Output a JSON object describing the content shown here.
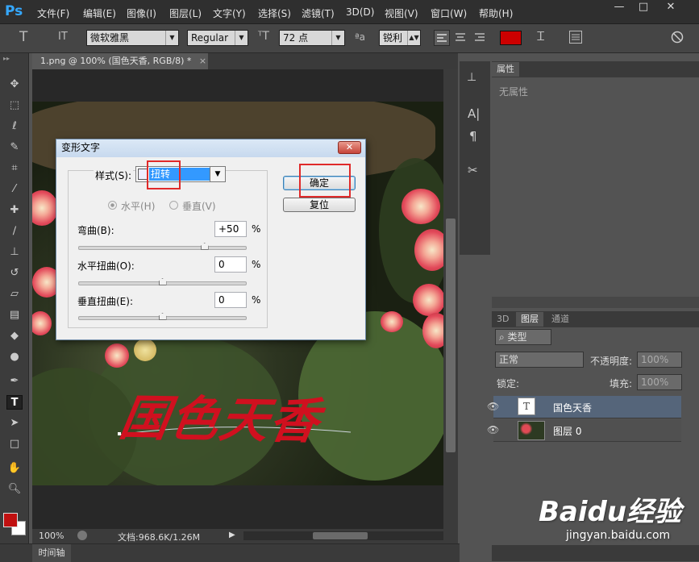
{
  "app": {
    "logo": "Ps",
    "accent_color": "#35a8ff"
  },
  "menu": [
    "文件(F)",
    "编辑(E)",
    "图像(I)",
    "图层(L)",
    "文字(Y)",
    "选择(S)",
    "滤镜(T)",
    "3D(D)",
    "视图(V)",
    "窗口(W)",
    "帮助(H)"
  ],
  "window_controls": {
    "minimize": "—",
    "maximize": "□",
    "close": "✕"
  },
  "options": {
    "tool_icon": "T",
    "orientation_icon": "IT",
    "font_family": "微软雅黑",
    "font_style": "Regular",
    "font_size": "72 点",
    "aa_label": "ªa",
    "antialias": "锐利",
    "text_color": "#cc0000"
  },
  "document": {
    "tab_title": "1.png @ 100% (国色天香, RGB/8) *",
    "close": "×",
    "text": "国色天香",
    "text_color": "#d0101f"
  },
  "dialog": {
    "title": "变形文字",
    "close": "✕",
    "style_label": "样式(S):",
    "style_value": "扭转",
    "orient_h": "水平(H)",
    "orient_v": "垂直(V)",
    "bend_label": "弯曲(B):",
    "bend_value": "+50",
    "bend_level": 0.75,
    "hdist_label": "水平扭曲(O):",
    "hdist_value": "0",
    "hdist_level": 0.5,
    "vdist_label": "垂直扭曲(E):",
    "vdist_value": "0",
    "vdist_level": 0.5,
    "percent": "%",
    "ok": "确定",
    "reset": "复位"
  },
  "properties": {
    "tab": "属性",
    "empty": "无属性"
  },
  "layers_panel": {
    "tabs": [
      "3D",
      "图层",
      "通道"
    ],
    "filter_kind": "类型",
    "blend_mode": "正常",
    "opacity_label": "不透明度:",
    "opacity_value": "100%",
    "lock_label": "锁定:",
    "fill_label": "填充:",
    "fill_value": "100%",
    "layers": [
      {
        "name": "国色天香",
        "thumb": "T",
        "selected": true
      },
      {
        "name": "图层 0",
        "thumb": "photo",
        "selected": false
      }
    ]
  },
  "status": {
    "zoom": "100%",
    "doc": "文档:968.6K/1.26M"
  },
  "timeline": {
    "label": "时间轴"
  },
  "watermark": {
    "brand": "Baidu经验",
    "url": "jingyan.baidu.com"
  }
}
